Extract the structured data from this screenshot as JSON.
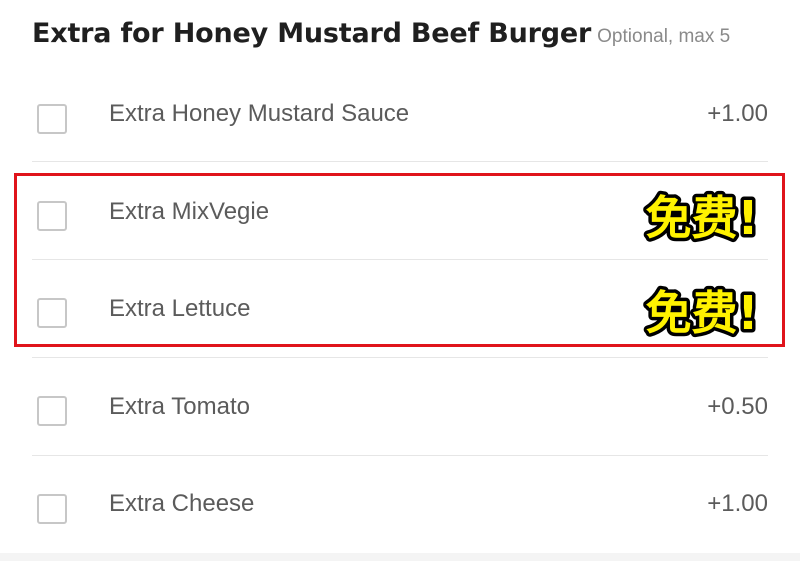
{
  "header": {
    "title": "Extra for Honey Mustard Beef Burger",
    "subtitle": "Optional, max 5"
  },
  "options": [
    {
      "label": "Extra Honey Mustard Sauce",
      "price": "+1.00",
      "checked": false
    },
    {
      "label": "Extra MixVegie",
      "price": "",
      "checked": false
    },
    {
      "label": "Extra Lettuce",
      "price": "",
      "checked": false
    },
    {
      "label": "Extra Tomato",
      "price": "+0.50",
      "checked": false
    },
    {
      "label": "Extra Cheese",
      "price": "+1.00",
      "checked": false
    }
  ],
  "annotations": {
    "free_badge_text": "免费!",
    "badge_fill": "#fff200",
    "badge_outline": "#000000",
    "highlight_color": "#e0141b"
  }
}
